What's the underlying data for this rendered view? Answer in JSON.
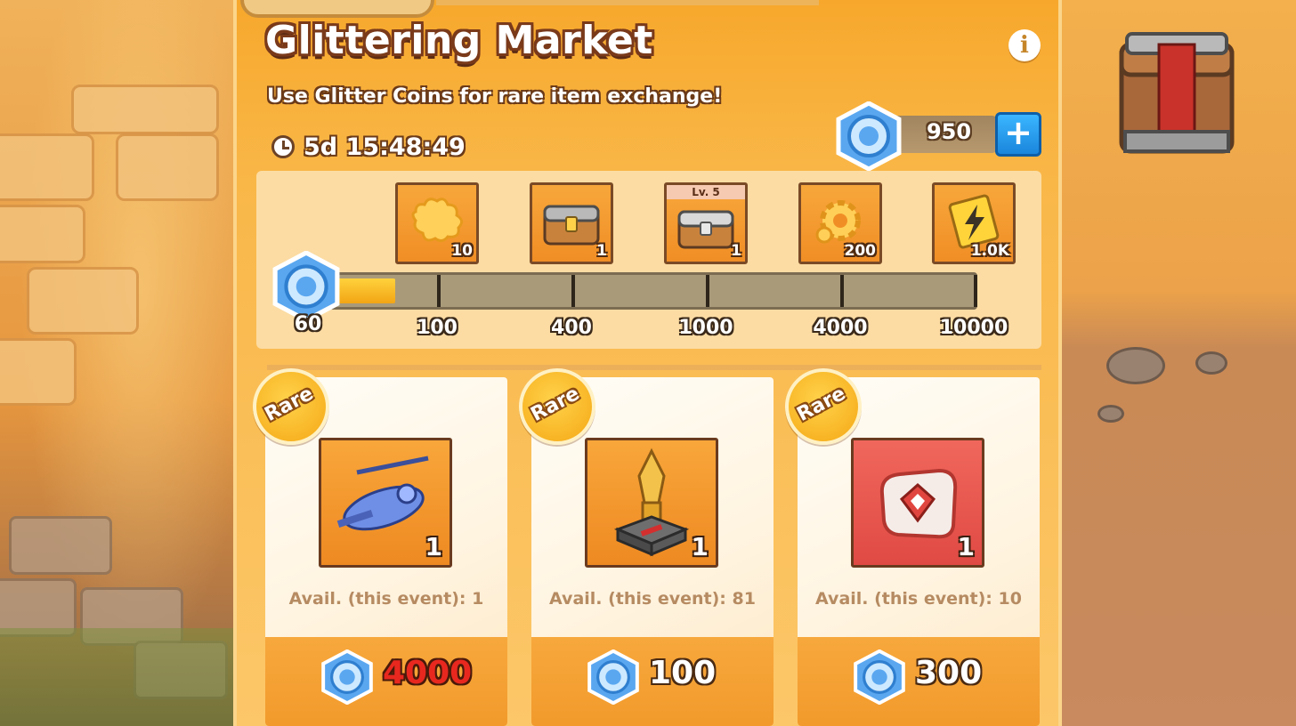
{
  "market": {
    "title": "Glittering Market",
    "subtitle": "Use Glitter Coins for rare item exchange!",
    "timer": "5d 15:48:49",
    "info_icon": "info-icon"
  },
  "currency": {
    "name": "Glitter Coins",
    "balance": "950",
    "add_label": "+",
    "icon": "glitter-coin-icon"
  },
  "progress": {
    "current_value": "60",
    "current_fraction_of_first_tier": 0.6,
    "milestones": [
      {
        "threshold": "100",
        "reward_icon": "puzzle-piece-icon",
        "quantity": "10"
      },
      {
        "threshold": "400",
        "reward_icon": "gold-chest-icon",
        "quantity": "1"
      },
      {
        "threshold": "1000",
        "reward_icon": "silver-chest-icon",
        "quantity": "1",
        "level_label": "Lv. 5"
      },
      {
        "threshold": "4000",
        "reward_icon": "gear-icon",
        "quantity": "200"
      },
      {
        "threshold": "10000",
        "reward_icon": "energy-ticket-icon",
        "quantity": "1.0K"
      }
    ]
  },
  "items": [
    {
      "badge": "Rare",
      "icon": "helicopter-icon",
      "quantity": "1",
      "availability": "Avail. (this event): 1",
      "price": "4000",
      "affordable": false,
      "bg": "orange"
    },
    {
      "badge": "Rare",
      "icon": "trophy-pedestal-icon",
      "quantity": "1",
      "availability": "Avail. (this event): 81",
      "price": "100",
      "affordable": true,
      "bg": "orange"
    },
    {
      "badge": "Rare",
      "icon": "badge-card-icon",
      "quantity": "1",
      "availability": "Avail. (this event): 10",
      "price": "300",
      "affordable": true,
      "bg": "red"
    }
  ],
  "colors": {
    "panel": "#f9b748",
    "accent_blue": "#1a86dc",
    "price_insufficient": "#e8281f",
    "progress_fill": "#ffd23c"
  }
}
